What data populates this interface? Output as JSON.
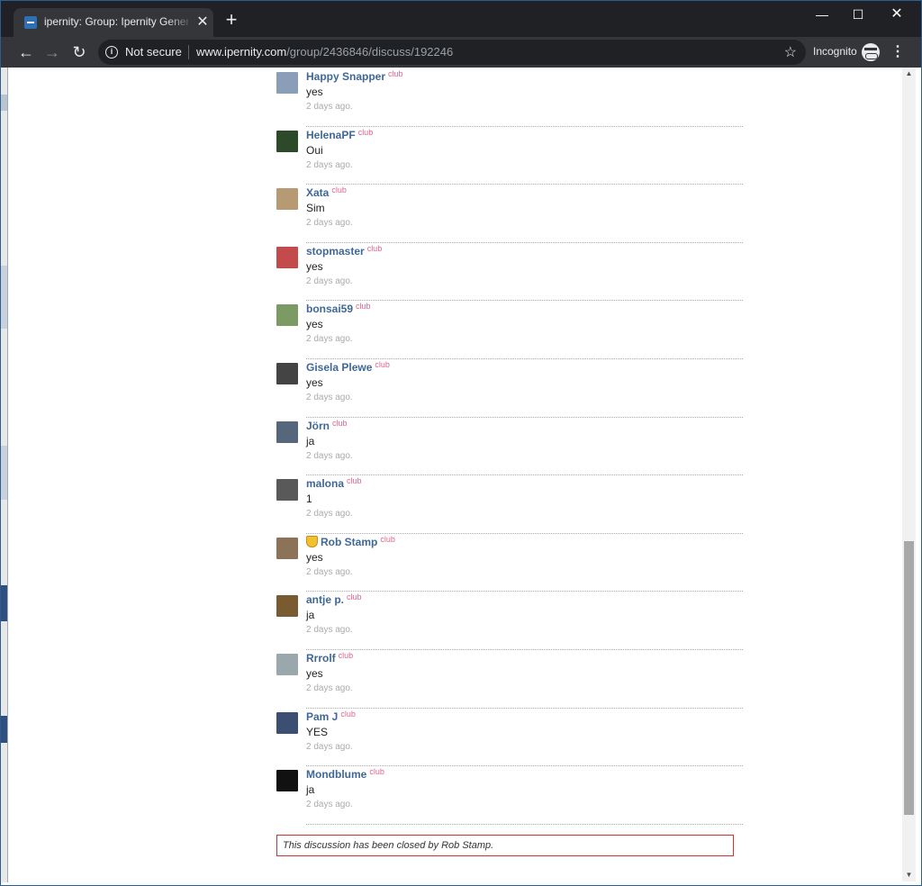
{
  "browser": {
    "tab_title": "ipernity: Group: Ipernity General",
    "tab_close": "✕",
    "new_tab": "+",
    "not_secure": "Not secure",
    "url_host": "www.ipernity.com",
    "url_path": "/group/2436846/discuss/192246",
    "incognito_label": "Incognito",
    "window_controls": {
      "minimize": "—",
      "maximize": "☐",
      "close": "✕"
    }
  },
  "comments": [
    {
      "author": "Happy Snapper",
      "badge": "club",
      "text": "yes",
      "time": "2 days ago.",
      "avatar_color": "#8a9fb7",
      "admin": false
    },
    {
      "author": "HelenaPF",
      "badge": "club",
      "text": "Oui",
      "time": "2 days ago.",
      "avatar_color": "#2c4a2a",
      "admin": false
    },
    {
      "author": "Xata",
      "badge": "club",
      "text": "Sim",
      "time": "2 days ago.",
      "avatar_color": "#b59a74",
      "admin": false
    },
    {
      "author": "stopmaster",
      "badge": "club",
      "text": "yes",
      "time": "2 days ago.",
      "avatar_color": "#c44b4b",
      "admin": false
    },
    {
      "author": "bonsai59",
      "badge": "club",
      "text": "yes",
      "time": "2 days ago.",
      "avatar_color": "#7c9a63",
      "admin": false
    },
    {
      "author": "Gisela Plewe",
      "badge": "club",
      "text": "yes",
      "time": "2 days ago.",
      "avatar_color": "#444444",
      "admin": false
    },
    {
      "author": "Jörn",
      "badge": "club",
      "text": "ja",
      "time": "2 days ago.",
      "avatar_color": "#56677c",
      "admin": false
    },
    {
      "author": "malona",
      "badge": "club",
      "text": "1",
      "time": "2 days ago.",
      "avatar_color": "#595959",
      "admin": false
    },
    {
      "author": "Rob Stamp",
      "badge": "club",
      "text": "yes",
      "time": "2 days ago.",
      "avatar_color": "#8c7357",
      "admin": true
    },
    {
      "author": "antje p.",
      "badge": "club",
      "text": "ja",
      "time": "2 days ago.",
      "avatar_color": "#7a5a30",
      "admin": false
    },
    {
      "author": "Rrrolf",
      "badge": "club",
      "text": "yes",
      "time": "2 days ago.",
      "avatar_color": "#9aa8ad",
      "admin": false
    },
    {
      "author": "Pam J",
      "badge": "club",
      "text": "YES",
      "time": "2 days ago.",
      "avatar_color": "#3b4f73",
      "admin": false
    },
    {
      "author": "Mondblume",
      "badge": "club",
      "text": "ja",
      "time": "2 days ago.",
      "avatar_color": "#111111",
      "admin": false
    }
  ],
  "closed_notice": "This discussion has been closed by Rob Stamp."
}
